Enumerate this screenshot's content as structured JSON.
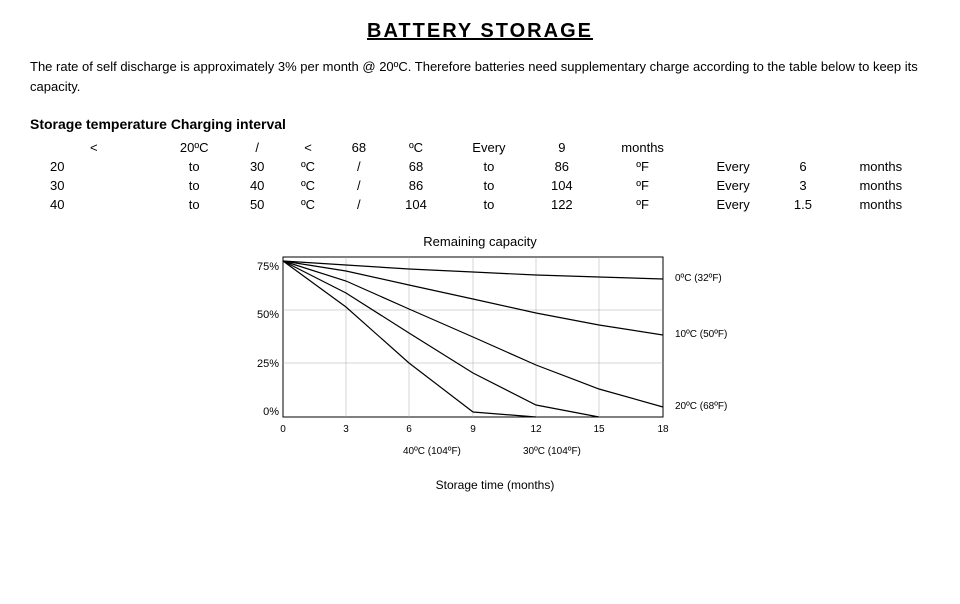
{
  "title": "BATTERY STORAGE",
  "intro": "The rate of self discharge is approximately 3% per month @ 20ºC. Therefore batteries need supplementary charge according to the table below to keep its capacity.",
  "storage_header": "Storage temperature  Charging interval",
  "table_rows": [
    {
      "col1": "<",
      "col2": "20ºC",
      "col3": "/",
      "col4": "<",
      "col5": "68",
      "col6": "ºC",
      "col7": "Every",
      "col8": "9",
      "col9": "months"
    },
    {
      "col1": "20",
      "col2": "to",
      "col3": "30",
      "col4": "ºC",
      "col5": "/",
      "col6": "68",
      "col7": "to",
      "col8": "86",
      "col9": "ºF",
      "col10": "Every",
      "col11": "6",
      "col12": "months"
    },
    {
      "col1": "30",
      "col2": "to",
      "col3": "40",
      "col4": "ºC",
      "col5": "/",
      "col6": "86",
      "col7": "to",
      "col8": "104",
      "col9": "ºF",
      "col10": "Every",
      "col11": "3",
      "col12": "months"
    },
    {
      "col1": "40",
      "col2": "to",
      "col3": "50",
      "col4": "ºC",
      "col5": "/",
      "col6": "104",
      "col7": "to",
      "col8": "122",
      "col9": "ºF",
      "col10": "Every",
      "col11": "1.5",
      "col12": "months"
    }
  ],
  "chart_title": "Remaining capacity",
  "y_axis_labels": [
    "75%",
    "50%",
    "25%",
    "0%"
  ],
  "x_axis_labels": [
    "0",
    "3",
    "6",
    "9",
    "12",
    "15",
    "18"
  ],
  "x_axis_title": "Storage time (months)",
  "legend": [
    {
      "label": "0ºC (32ºF)",
      "id": "line1"
    },
    {
      "label": "10ºC (50ºF)",
      "id": "line2"
    },
    {
      "label": "20ºC (68ºF)",
      "id": "line3"
    },
    {
      "label": "40ºC (104ºF)",
      "id": "line4"
    },
    {
      "label": "30ºC (104ºF)",
      "id": "line5"
    }
  ]
}
